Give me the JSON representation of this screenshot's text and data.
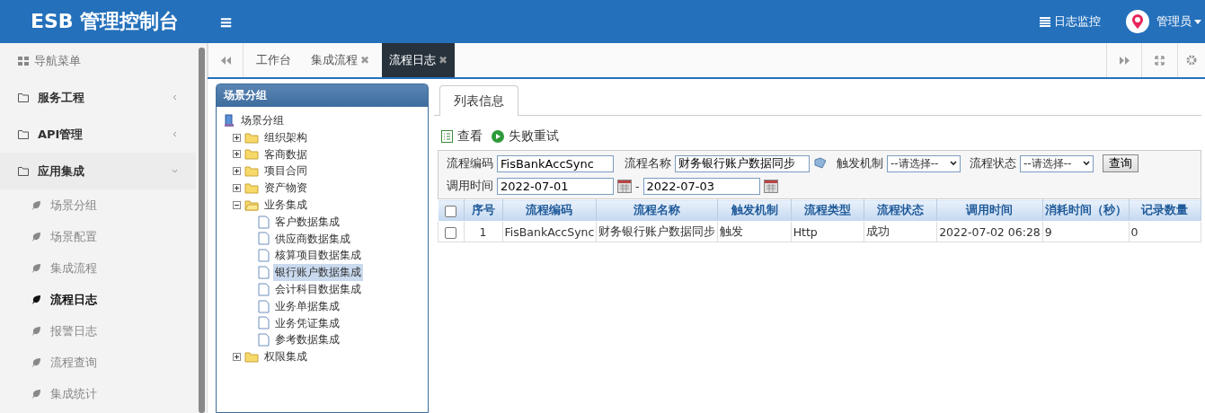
{
  "header": {
    "title": "ESB 管理控制台",
    "menu_icon": "≡",
    "monitor": "日志监控",
    "user": "管理员"
  },
  "sidebar": {
    "title": "导航菜单",
    "groups": [
      {
        "label": "服务工程",
        "expanded": false
      },
      {
        "label": "API管理",
        "expanded": false
      },
      {
        "label": "应用集成",
        "expanded": true,
        "items": [
          {
            "label": "场景分组",
            "selected": false
          },
          {
            "label": "场景配置",
            "selected": false
          },
          {
            "label": "集成流程",
            "selected": false
          },
          {
            "label": "流程日志",
            "selected": true
          },
          {
            "label": "报警日志",
            "selected": false
          },
          {
            "label": "流程查询",
            "selected": false
          },
          {
            "label": "集成统计",
            "selected": false
          }
        ]
      }
    ]
  },
  "tabs": [
    {
      "label": "工作台",
      "selected": false
    },
    {
      "label": "集成流程",
      "selected": false,
      "close": "✖"
    },
    {
      "label": "流程日志",
      "selected": true,
      "close": "✖"
    }
  ],
  "tree": {
    "title": "场景分组",
    "root": "场景分组",
    "children": [
      {
        "label": "组织架构",
        "expanded": false
      },
      {
        "label": "客商数据",
        "expanded": false
      },
      {
        "label": "项目合同",
        "expanded": false
      },
      {
        "label": "资产物资",
        "expanded": false
      },
      {
        "label": "业务集成",
        "expanded": true,
        "children": [
          {
            "label": "客户数据集成",
            "selected": false
          },
          {
            "label": "供应商数据集成",
            "selected": false
          },
          {
            "label": "核算项目数据集成",
            "selected": false
          },
          {
            "label": "银行账户数据集成",
            "selected": true
          },
          {
            "label": "会计科目数据集成",
            "selected": false
          },
          {
            "label": "业务单据集成",
            "selected": false
          },
          {
            "label": "业务凭证集成",
            "selected": false
          },
          {
            "label": "参考数据集成",
            "selected": false
          }
        ]
      },
      {
        "label": "权限集成",
        "expanded": false
      }
    ]
  },
  "panel": {
    "tab": "列表信息",
    "actions": [
      "查看",
      "失败重试"
    ],
    "filters": {
      "code_label": "流程编码",
      "code": "FisBankAccSync",
      "name_label": "流程名称",
      "name": "财务银行账户数据同步",
      "trigger_label": "触发机制",
      "trigger": "--请选择--",
      "status_label": "流程状态",
      "status": "--请选择--",
      "query": "查询",
      "time_label": "调用时间",
      "from": "2022-07-01",
      "sep": "-",
      "to": "2022-07-03"
    },
    "table": {
      "all_checked": false,
      "columns": [
        "序号",
        "流程编码",
        "流程名称",
        "触发机制",
        "流程类型",
        "流程状态",
        "调用时间",
        "消耗时间（秒）",
        "记录数量"
      ],
      "rows": [
        {
          "checked": false,
          "cells": [
            "1",
            "FisBankAccSync",
            "财务银行账户数据同步",
            "触发",
            "Http",
            "成功",
            "2022-07-02 06:28",
            "9",
            "0"
          ]
        }
      ]
    }
  }
}
